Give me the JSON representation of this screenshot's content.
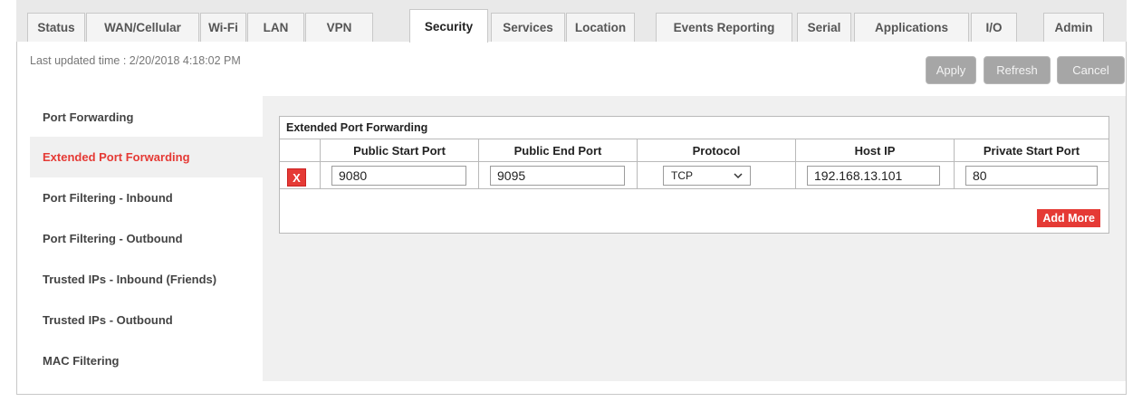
{
  "tabs": [
    {
      "label": "Status"
    },
    {
      "label": "WAN/Cellular"
    },
    {
      "label": "Wi-Fi"
    },
    {
      "label": "LAN"
    },
    {
      "label": "VPN"
    },
    {
      "label": "Security"
    },
    {
      "label": "Services"
    },
    {
      "label": "Location"
    },
    {
      "label": "Events Reporting"
    },
    {
      "label": "Serial"
    },
    {
      "label": "Applications"
    },
    {
      "label": "I/O"
    },
    {
      "label": "Admin"
    }
  ],
  "active_tab": "Security",
  "header": {
    "last_updated": "Last updated time : 2/20/2018 4:18:02 PM",
    "apply_label": "Apply",
    "refresh_label": "Refresh",
    "cancel_label": "Cancel"
  },
  "sidebar": {
    "items": [
      {
        "label": "Port Forwarding"
      },
      {
        "label": "Extended Port Forwarding"
      },
      {
        "label": "Port Filtering - Inbound"
      },
      {
        "label": "Port Filtering - Outbound"
      },
      {
        "label": "Trusted IPs - Inbound (Friends)"
      },
      {
        "label": "Trusted IPs - Outbound"
      },
      {
        "label": "MAC Filtering"
      }
    ],
    "active_item": "Extended Port Forwarding"
  },
  "table": {
    "title": "Extended Port Forwarding",
    "columns": [
      "Public Start Port",
      "Public End Port",
      "Protocol",
      "Host IP",
      "Private Start Port"
    ],
    "rows": [
      {
        "delete_label": "X",
        "public_start_port": "9080",
        "public_end_port": "9095",
        "protocol": "TCP",
        "host_ip": "192.168.13.101",
        "private_start_port": "80"
      }
    ],
    "add_more_label": "Add More"
  },
  "colors": {
    "accent_red": "#e53a35",
    "button_gray": "#a6a6a6",
    "panel_gray": "#f0f0f0"
  },
  "icons": {
    "protocol_dropdown": "chevron-down-icon"
  }
}
